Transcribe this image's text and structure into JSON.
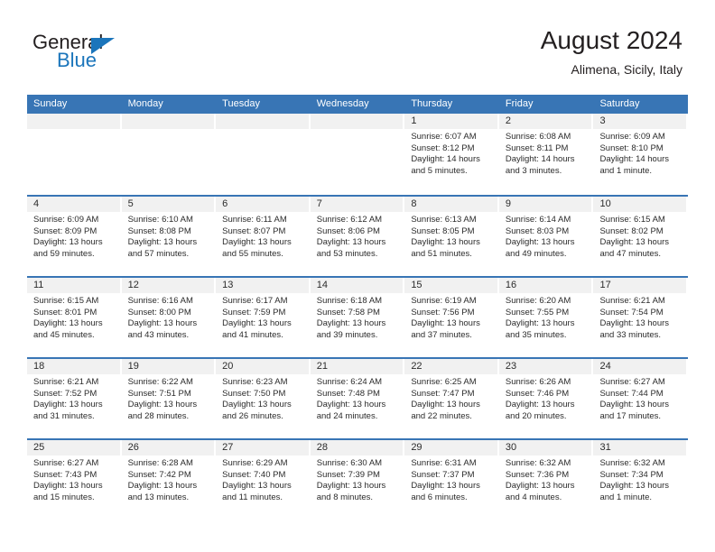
{
  "brand": {
    "logo_word1": "General",
    "logo_word2": "Blue",
    "logo_triangle_icon": "triangle-icon",
    "accent_color": "#1b75bb"
  },
  "header": {
    "title": "August 2024",
    "subtitle": "Alimena, Sicily, Italy"
  },
  "colors": {
    "header_blue": "#3875b5",
    "day_band_gray": "#f1f1f1",
    "text": "#2b2b2b"
  },
  "weekdays": [
    "Sunday",
    "Monday",
    "Tuesday",
    "Wednesday",
    "Thursday",
    "Friday",
    "Saturday"
  ],
  "weeks": [
    [
      {
        "day": "",
        "sunrise": "",
        "sunset": "",
        "daylight": "",
        "daylight2": ""
      },
      {
        "day": "",
        "sunrise": "",
        "sunset": "",
        "daylight": "",
        "daylight2": ""
      },
      {
        "day": "",
        "sunrise": "",
        "sunset": "",
        "daylight": "",
        "daylight2": ""
      },
      {
        "day": "",
        "sunrise": "",
        "sunset": "",
        "daylight": "",
        "daylight2": ""
      },
      {
        "day": "1",
        "sunrise": "Sunrise: 6:07 AM",
        "sunset": "Sunset: 8:12 PM",
        "daylight": "Daylight: 14 hours",
        "daylight2": "and 5 minutes."
      },
      {
        "day": "2",
        "sunrise": "Sunrise: 6:08 AM",
        "sunset": "Sunset: 8:11 PM",
        "daylight": "Daylight: 14 hours",
        "daylight2": "and 3 minutes."
      },
      {
        "day": "3",
        "sunrise": "Sunrise: 6:09 AM",
        "sunset": "Sunset: 8:10 PM",
        "daylight": "Daylight: 14 hours",
        "daylight2": "and 1 minute."
      }
    ],
    [
      {
        "day": "4",
        "sunrise": "Sunrise: 6:09 AM",
        "sunset": "Sunset: 8:09 PM",
        "daylight": "Daylight: 13 hours",
        "daylight2": "and 59 minutes."
      },
      {
        "day": "5",
        "sunrise": "Sunrise: 6:10 AM",
        "sunset": "Sunset: 8:08 PM",
        "daylight": "Daylight: 13 hours",
        "daylight2": "and 57 minutes."
      },
      {
        "day": "6",
        "sunrise": "Sunrise: 6:11 AM",
        "sunset": "Sunset: 8:07 PM",
        "daylight": "Daylight: 13 hours",
        "daylight2": "and 55 minutes."
      },
      {
        "day": "7",
        "sunrise": "Sunrise: 6:12 AM",
        "sunset": "Sunset: 8:06 PM",
        "daylight": "Daylight: 13 hours",
        "daylight2": "and 53 minutes."
      },
      {
        "day": "8",
        "sunrise": "Sunrise: 6:13 AM",
        "sunset": "Sunset: 8:05 PM",
        "daylight": "Daylight: 13 hours",
        "daylight2": "and 51 minutes."
      },
      {
        "day": "9",
        "sunrise": "Sunrise: 6:14 AM",
        "sunset": "Sunset: 8:03 PM",
        "daylight": "Daylight: 13 hours",
        "daylight2": "and 49 minutes."
      },
      {
        "day": "10",
        "sunrise": "Sunrise: 6:15 AM",
        "sunset": "Sunset: 8:02 PM",
        "daylight": "Daylight: 13 hours",
        "daylight2": "and 47 minutes."
      }
    ],
    [
      {
        "day": "11",
        "sunrise": "Sunrise: 6:15 AM",
        "sunset": "Sunset: 8:01 PM",
        "daylight": "Daylight: 13 hours",
        "daylight2": "and 45 minutes."
      },
      {
        "day": "12",
        "sunrise": "Sunrise: 6:16 AM",
        "sunset": "Sunset: 8:00 PM",
        "daylight": "Daylight: 13 hours",
        "daylight2": "and 43 minutes."
      },
      {
        "day": "13",
        "sunrise": "Sunrise: 6:17 AM",
        "sunset": "Sunset: 7:59 PM",
        "daylight": "Daylight: 13 hours",
        "daylight2": "and 41 minutes."
      },
      {
        "day": "14",
        "sunrise": "Sunrise: 6:18 AM",
        "sunset": "Sunset: 7:58 PM",
        "daylight": "Daylight: 13 hours",
        "daylight2": "and 39 minutes."
      },
      {
        "day": "15",
        "sunrise": "Sunrise: 6:19 AM",
        "sunset": "Sunset: 7:56 PM",
        "daylight": "Daylight: 13 hours",
        "daylight2": "and 37 minutes."
      },
      {
        "day": "16",
        "sunrise": "Sunrise: 6:20 AM",
        "sunset": "Sunset: 7:55 PM",
        "daylight": "Daylight: 13 hours",
        "daylight2": "and 35 minutes."
      },
      {
        "day": "17",
        "sunrise": "Sunrise: 6:21 AM",
        "sunset": "Sunset: 7:54 PM",
        "daylight": "Daylight: 13 hours",
        "daylight2": "and 33 minutes."
      }
    ],
    [
      {
        "day": "18",
        "sunrise": "Sunrise: 6:21 AM",
        "sunset": "Sunset: 7:52 PM",
        "daylight": "Daylight: 13 hours",
        "daylight2": "and 31 minutes."
      },
      {
        "day": "19",
        "sunrise": "Sunrise: 6:22 AM",
        "sunset": "Sunset: 7:51 PM",
        "daylight": "Daylight: 13 hours",
        "daylight2": "and 28 minutes."
      },
      {
        "day": "20",
        "sunrise": "Sunrise: 6:23 AM",
        "sunset": "Sunset: 7:50 PM",
        "daylight": "Daylight: 13 hours",
        "daylight2": "and 26 minutes."
      },
      {
        "day": "21",
        "sunrise": "Sunrise: 6:24 AM",
        "sunset": "Sunset: 7:48 PM",
        "daylight": "Daylight: 13 hours",
        "daylight2": "and 24 minutes."
      },
      {
        "day": "22",
        "sunrise": "Sunrise: 6:25 AM",
        "sunset": "Sunset: 7:47 PM",
        "daylight": "Daylight: 13 hours",
        "daylight2": "and 22 minutes."
      },
      {
        "day": "23",
        "sunrise": "Sunrise: 6:26 AM",
        "sunset": "Sunset: 7:46 PM",
        "daylight": "Daylight: 13 hours",
        "daylight2": "and 20 minutes."
      },
      {
        "day": "24",
        "sunrise": "Sunrise: 6:27 AM",
        "sunset": "Sunset: 7:44 PM",
        "daylight": "Daylight: 13 hours",
        "daylight2": "and 17 minutes."
      }
    ],
    [
      {
        "day": "25",
        "sunrise": "Sunrise: 6:27 AM",
        "sunset": "Sunset: 7:43 PM",
        "daylight": "Daylight: 13 hours",
        "daylight2": "and 15 minutes."
      },
      {
        "day": "26",
        "sunrise": "Sunrise: 6:28 AM",
        "sunset": "Sunset: 7:42 PM",
        "daylight": "Daylight: 13 hours",
        "daylight2": "and 13 minutes."
      },
      {
        "day": "27",
        "sunrise": "Sunrise: 6:29 AM",
        "sunset": "Sunset: 7:40 PM",
        "daylight": "Daylight: 13 hours",
        "daylight2": "and 11 minutes."
      },
      {
        "day": "28",
        "sunrise": "Sunrise: 6:30 AM",
        "sunset": "Sunset: 7:39 PM",
        "daylight": "Daylight: 13 hours",
        "daylight2": "and 8 minutes."
      },
      {
        "day": "29",
        "sunrise": "Sunrise: 6:31 AM",
        "sunset": "Sunset: 7:37 PM",
        "daylight": "Daylight: 13 hours",
        "daylight2": "and 6 minutes."
      },
      {
        "day": "30",
        "sunrise": "Sunrise: 6:32 AM",
        "sunset": "Sunset: 7:36 PM",
        "daylight": "Daylight: 13 hours",
        "daylight2": "and 4 minutes."
      },
      {
        "day": "31",
        "sunrise": "Sunrise: 6:32 AM",
        "sunset": "Sunset: 7:34 PM",
        "daylight": "Daylight: 13 hours",
        "daylight2": "and 1 minute."
      }
    ]
  ]
}
